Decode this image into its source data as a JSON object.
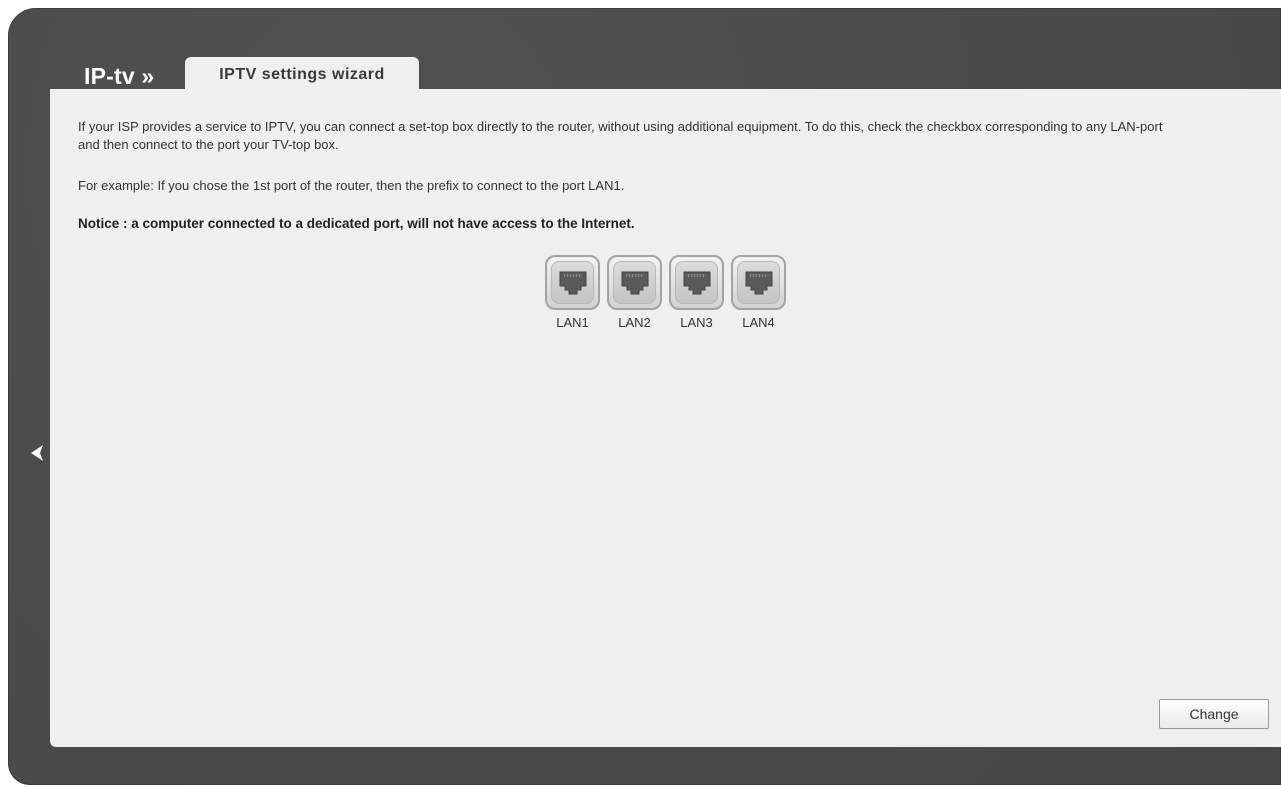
{
  "header": {
    "title": "IP-tv »",
    "tab_label": "IPTV settings wizard"
  },
  "content": {
    "paragraph1": "If your ISP provides a service to IPTV, you can connect a set-top box directly to the router, without using additional equipment. To do this, check the checkbox corresponding to any LAN-port and then connect to the port your TV-top box.",
    "paragraph2": "For example: If you chose the 1st port of the router, then the prefix to connect to the port LAN1.",
    "notice": "Notice : a computer connected to a dedicated port, will not have access to the Internet."
  },
  "ports": [
    {
      "label": "LAN1",
      "icon": "ethernet-port-icon",
      "selected": false
    },
    {
      "label": "LAN2",
      "icon": "ethernet-port-icon",
      "selected": false
    },
    {
      "label": "LAN3",
      "icon": "ethernet-port-icon",
      "selected": false
    },
    {
      "label": "LAN4",
      "icon": "ethernet-port-icon",
      "selected": false
    }
  ],
  "actions": {
    "change_label": "Change"
  },
  "navigation": {
    "back_icon": "chevron-left-icon"
  },
  "colors": {
    "frame": "#4a4a4a",
    "panel": "#efefef",
    "title_text": "#ffffff"
  }
}
